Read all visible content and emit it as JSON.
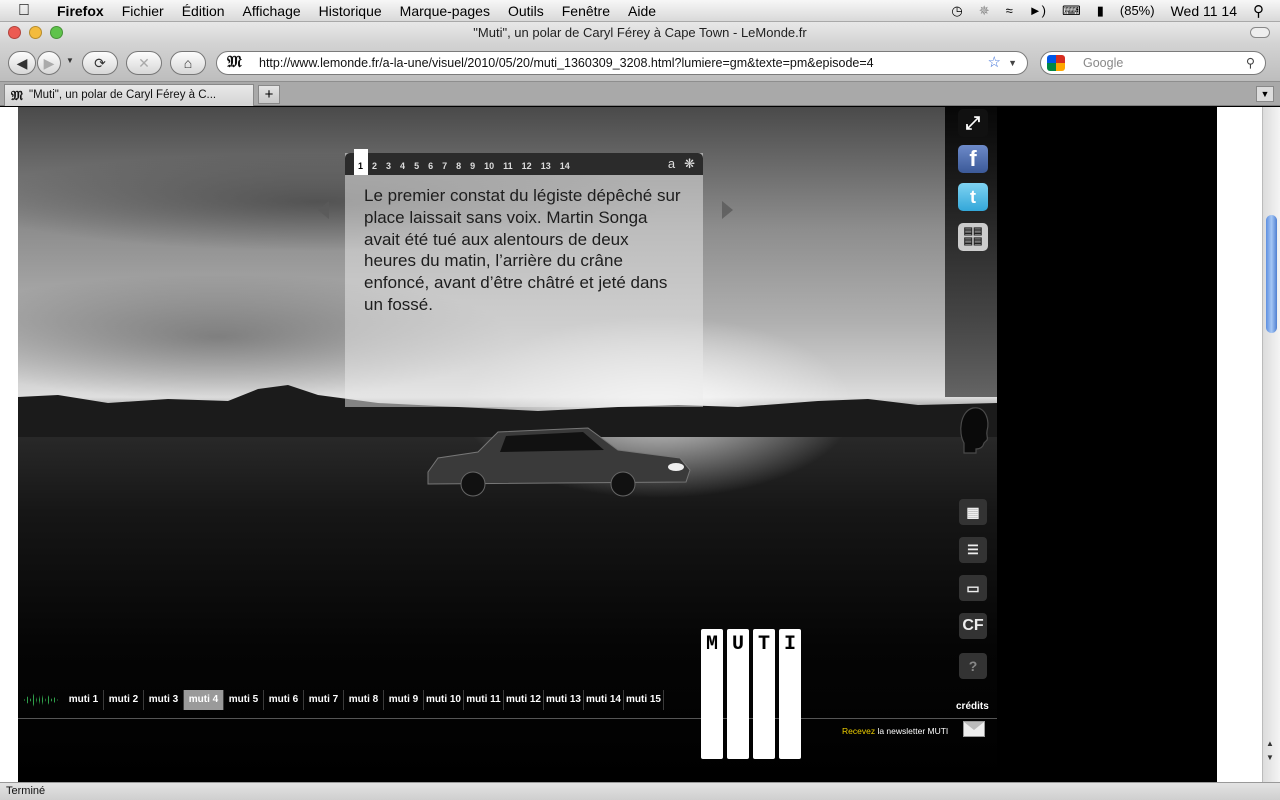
{
  "menubar": {
    "apple": "",
    "app": "Firefox",
    "items": [
      "Fichier",
      "Édition",
      "Affichage",
      "Historique",
      "Marque-pages",
      "Outils",
      "Fenêtre",
      "Aide"
    ],
    "battery": "(85%)",
    "clock": "Wed 11 14"
  },
  "window": {
    "title": "\"Muti\", un polar de Caryl Férey à Cape Town - LeMonde.fr"
  },
  "toolbar": {
    "url": "http://www.lemonde.fr/a-la-une/visuel/2010/05/20/muti_1360309_3208.html?lumiere=gm&texte=pm&episode=4",
    "search_placeholder": "Google"
  },
  "tabs": [
    {
      "label": "\"Muti\", un polar de Caryl Férey à C...",
      "active": true
    }
  ],
  "page": {
    "pager": [
      "1",
      "2",
      "3",
      "4",
      "5",
      "6",
      "7",
      "8",
      "9",
      "10",
      "11",
      "12",
      "13",
      "14"
    ],
    "pager_active": "1",
    "text_tool": "a",
    "body": "Le premier constat du légiste dépêché sur place laissait sans voix. Martin Songa avait été tué aux alentours de deux heures du matin, l’arrière du crâne enfoncé, avant d’être châtré et jeté dans un fossé.",
    "episodes": [
      "muti 1",
      "muti 2",
      "muti 3",
      "muti 4",
      "muti 5",
      "muti 6",
      "muti 7",
      "muti 8",
      "muti 9",
      "muti 10",
      "muti 11",
      "muti 12",
      "muti 13",
      "muti 14",
      "muti 15"
    ],
    "episode_active": "muti 4",
    "logo_letters": [
      "M",
      "U",
      "T",
      "I"
    ],
    "credits": "crédits",
    "newsletter_highlight": "Recevez",
    "newsletter_rest": " la newsletter MUTI",
    "sidebar_icons": [
      "expand-icon",
      "facebook-icon",
      "twitter-icon",
      "newspaper-icon"
    ],
    "menu_icons": [
      "grid-icon",
      "list-icon",
      "computer-icon",
      "cf-icon",
      "help-icon"
    ],
    "cf_label": "CF",
    "help_label": "?"
  },
  "status": "Terminé",
  "colors": {
    "accent_yellow": "#f0d000",
    "wave_green": "#2fa04a"
  }
}
